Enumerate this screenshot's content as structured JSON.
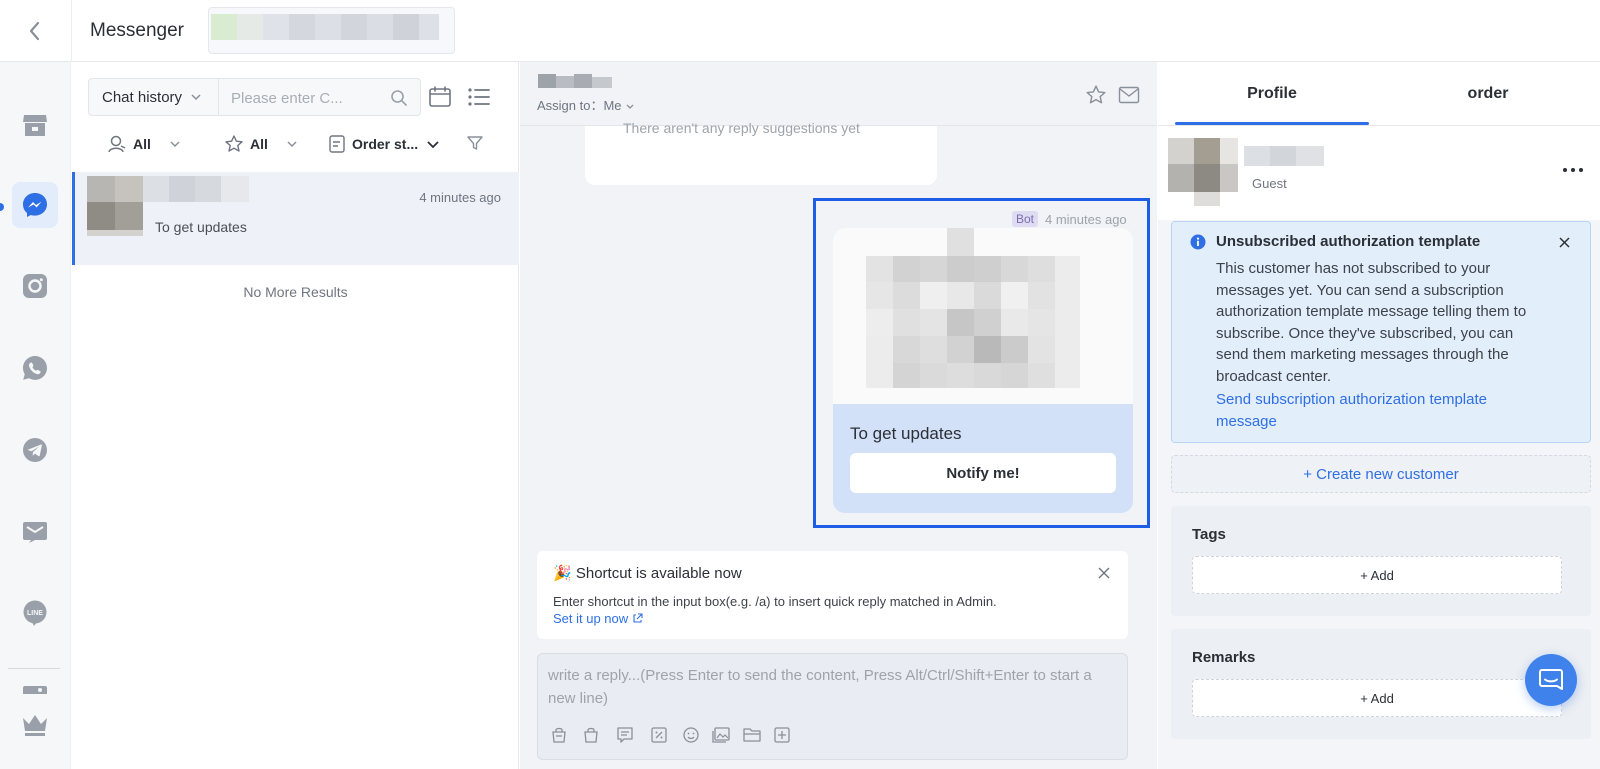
{
  "header": {
    "title": "Messenger",
    "back_icon": "chevron-left-icon"
  },
  "rail": {
    "items": [
      {
        "icon": "store-icon"
      },
      {
        "icon": "messenger-icon",
        "active": true
      },
      {
        "icon": "instagram-icon"
      },
      {
        "icon": "whatsapp-icon"
      },
      {
        "icon": "telegram-icon"
      },
      {
        "icon": "email-icon"
      },
      {
        "icon": "line-icon"
      },
      {
        "icon": "image-icon"
      },
      {
        "icon": "crown-icon"
      }
    ],
    "accent": "#2f6fe6"
  },
  "list": {
    "filter_label": "Chat history",
    "search_placeholder": "Please enter C...",
    "filters": {
      "assignee": "All",
      "star": "All",
      "order_status": "Order st..."
    },
    "conversations": [
      {
        "time": "4 minutes ago",
        "preview": "To get updates"
      }
    ],
    "end_text": "No More Results"
  },
  "chat": {
    "assign_label": "Assign to：Me",
    "prev_message": "There aren't any reply suggestions yet",
    "message": {
      "sender_badge": "Bot",
      "time": "4 minutes ago",
      "title": "To get updates",
      "button_label": "Notify me!"
    },
    "shortcut": {
      "title": "🎉 Shortcut is available now",
      "description": "Enter shortcut in the input box(e.g. /a) to insert quick reply matched in Admin.",
      "link": "Set it up now"
    },
    "reply_placeholder": "write a reply...(Press Enter to send the content, Press Alt/Ctrl/Shift+Enter to start a new line)"
  },
  "profile": {
    "tabs": [
      "Profile",
      "order"
    ],
    "guest_label": "Guest",
    "notice": {
      "title": "Unsubscribed authorization template",
      "body": "This customer has not subscribed to your messages yet. You can send a subscription authorization template message telling them to subscribe. Once they've subscribed, you can send them marketing messages through the broadcast center.",
      "link": "Send subscription authorization template message"
    },
    "create_customer": "+ Create new customer",
    "tags": {
      "title": "Tags",
      "add": "+ Add"
    },
    "remarks": {
      "title": "Remarks",
      "add": "+ Add"
    }
  }
}
